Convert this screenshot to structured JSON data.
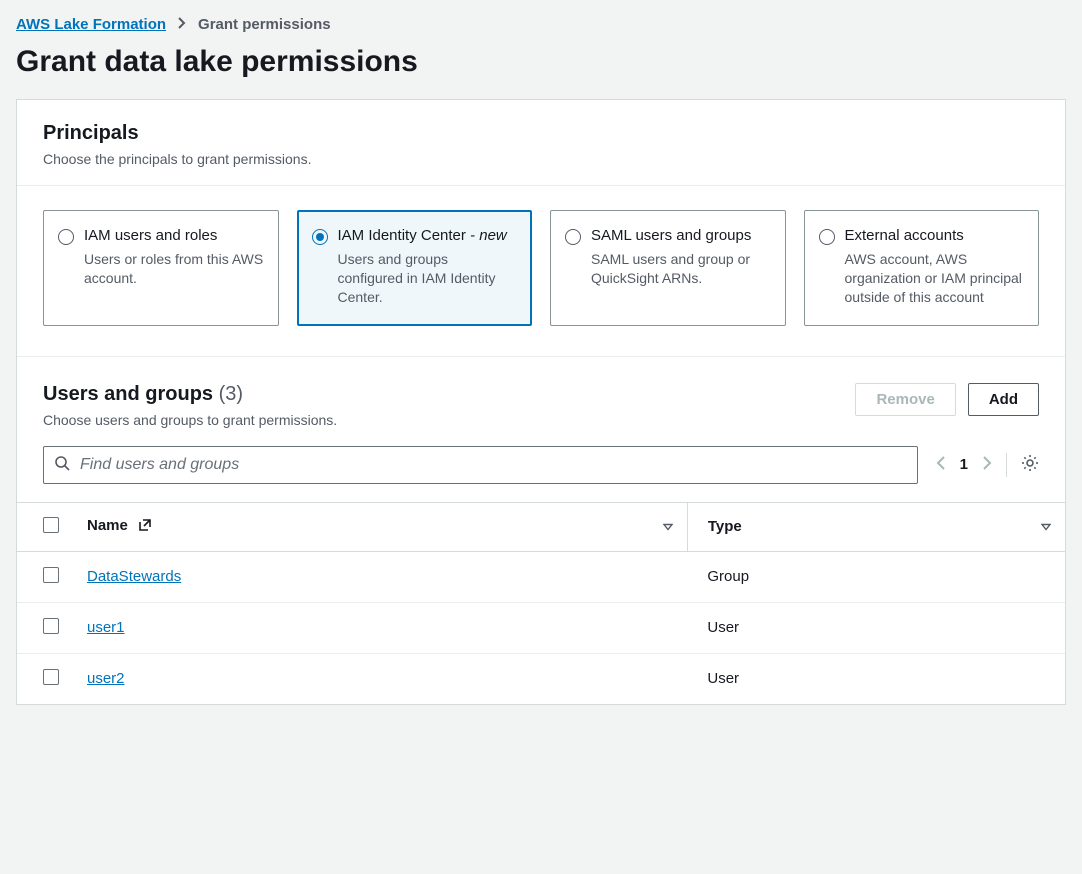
{
  "breadcrumb": {
    "root": "AWS Lake Formation",
    "current": "Grant permissions"
  },
  "page_title": "Grant data lake permissions",
  "principals": {
    "heading": "Principals",
    "description": "Choose the principals to grant permissions.",
    "options": [
      {
        "title": "IAM users and roles",
        "suffix": "",
        "desc": "Users or roles from this AWS account.",
        "selected": false
      },
      {
        "title": "IAM Identity Center",
        "suffix": " - new",
        "desc": "Users and groups configured in IAM Identity Center.",
        "selected": true
      },
      {
        "title": "SAML users and groups",
        "suffix": "",
        "desc": "SAML users and group or QuickSight ARNs.",
        "selected": false
      },
      {
        "title": "External accounts",
        "suffix": "",
        "desc": "AWS account, AWS organization or IAM principal outside of this account",
        "selected": false
      }
    ]
  },
  "users_groups": {
    "heading": "Users and groups",
    "count": "(3)",
    "description": "Choose users and groups to grant permissions.",
    "remove_label": "Remove",
    "add_label": "Add",
    "search_placeholder": "Find users and groups",
    "page": "1",
    "columns": {
      "name": "Name",
      "type": "Type"
    },
    "rows": [
      {
        "name": "DataStewards",
        "type": "Group"
      },
      {
        "name": "user1",
        "type": "User"
      },
      {
        "name": "user2",
        "type": "User"
      }
    ]
  }
}
